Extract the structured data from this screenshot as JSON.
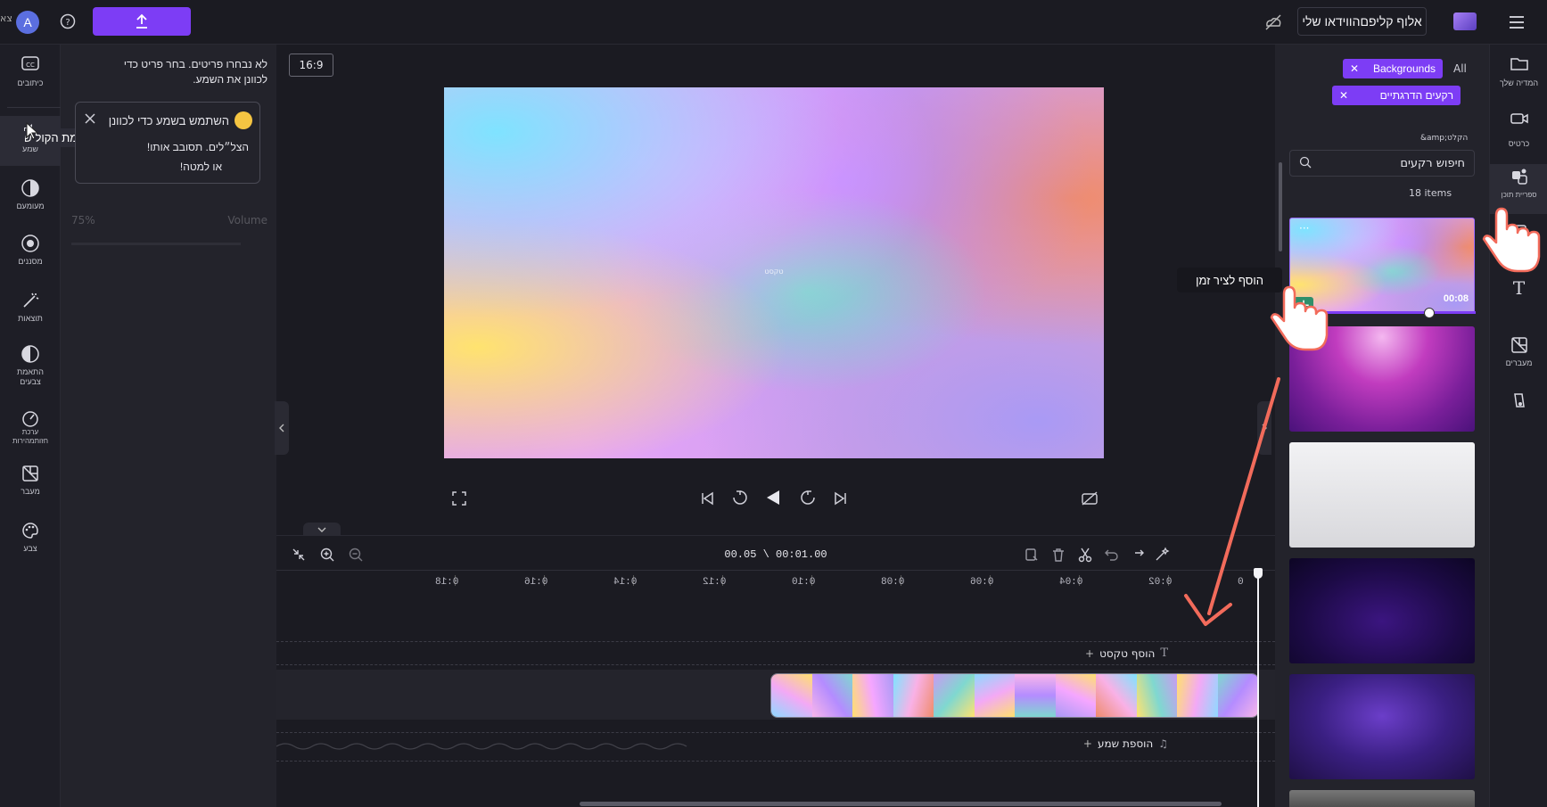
{
  "topbar": {
    "avatar_letter": "A",
    "project_title": "אלוף קליפםהווידאו שלי",
    "left_clipped_text": "צא"
  },
  "left_rail": {
    "items": [
      {
        "label": "כיתובים",
        "icon": "captions-icon"
      },
      {
        "label": "את עוצמת הקול של",
        "icon": "audio-icon"
      },
      {
        "label": "מעומעם",
        "icon": "fade-icon"
      },
      {
        "label": "מסננים",
        "icon": "filters-icon"
      },
      {
        "label": "תוצאות",
        "icon": "effects-icon"
      },
      {
        "label": "התאמת צבעים",
        "icon": "adjust-colors-icon"
      },
      {
        "label": "ערכת חזותמהירות",
        "icon": "speed-icon"
      },
      {
        "label": "מעבר",
        "icon": "transition-icon"
      },
      {
        "label": "צבע",
        "icon": "color-icon"
      }
    ],
    "speed_overlay": "שמע"
  },
  "left_panel": {
    "no_selection_line1": "לא נבחרו פריטים. בחר פריט כדי",
    "no_selection_line2": "לכוונן את השמע.",
    "tip_title": "השתמש בשמע כדי לכוונן",
    "tip_body": "הצל״לים. תסובב אותו!",
    "tip_link": "או למטה!",
    "volume_label": "Volume",
    "volume_value": "75%",
    "audio_overlay_text": "את עוצמת הקול של"
  },
  "preview": {
    "aspect_ratio": "16:9",
    "watermark": "טקסט"
  },
  "timeline": {
    "time_current": "00:00.05",
    "time_total": "00:01.00",
    "time_display": "00.05 \\ 00:01.00",
    "ticks": [
      "0",
      "0:02",
      "0:04",
      "0:06",
      "0:08",
      "0:10",
      "0:12",
      "0:14",
      "0:16",
      "0:18"
    ],
    "add_text": "הוסף טקסט",
    "add_audio": "הוספת שמע",
    "playhead_fraction": 0.0
  },
  "right_panel": {
    "filter_all": "All",
    "tag_backgrounds": "Backgrounds",
    "tag_hebrew": "רקעים הדרגתיים",
    "search_placeholder": "חיפוש רקעים",
    "items_count": "18 items",
    "thumb_duration": "00:08",
    "add_to_timeline_tooltip": "הוסף לציר זמן"
  },
  "right_rail": {
    "items": [
      {
        "label": "המדיה שלך",
        "icon": "folder-icon"
      },
      {
        "label": "כרטיס",
        "icon": "record-icon"
      },
      {
        "label": "ספריית תוכן",
        "icon": "content-library-icon"
      },
      {
        "label": "",
        "icon": "templates-icon"
      },
      {
        "label": "",
        "icon": "text-icon"
      },
      {
        "label": "מעברים",
        "icon": "transitions-icon"
      },
      {
        "label": "",
        "icon": "brand-kit-icon"
      }
    ],
    "extra_caption": "&amp;הקלט"
  },
  "colors": {
    "accent": "#7d3df5",
    "annotation_arrow": "#f26b5b",
    "panel": "#23232b",
    "background": "#1b1b22"
  }
}
